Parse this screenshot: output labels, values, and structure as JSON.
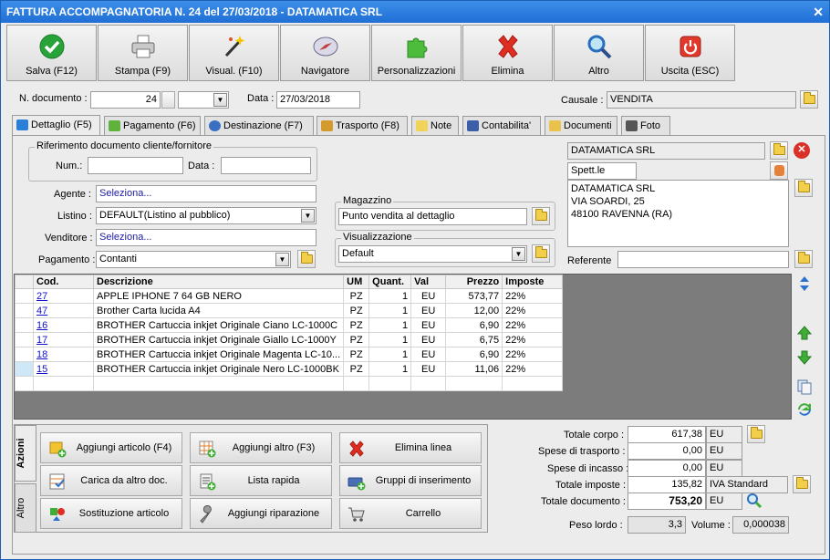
{
  "window": {
    "title": "FATTURA ACCOMPAGNATORIA N. 24 del 27/03/2018 - DATAMATICA SRL"
  },
  "toolbar": {
    "buttons": [
      {
        "label": "Salva (F12)",
        "icon": "check-icon"
      },
      {
        "label": "Stampa (F9)",
        "icon": "printer-icon"
      },
      {
        "label": "Visual. (F10)",
        "icon": "magic-wand-icon"
      },
      {
        "label": "Navigatore",
        "icon": "compass-icon"
      },
      {
        "label": "Personalizzazioni",
        "icon": "puzzle-icon"
      },
      {
        "label": "Elimina",
        "icon": "delete-x-icon"
      },
      {
        "label": "Altro",
        "icon": "magnifier-icon"
      },
      {
        "label": "Uscita (ESC)",
        "icon": "power-icon"
      }
    ]
  },
  "header": {
    "doc_number_label": "N. documento :",
    "doc_number": "24",
    "doc_suffix": "",
    "date_label": "Data :",
    "date": "27/03/2018",
    "causale_label": "Causale :",
    "causale": "VENDITA"
  },
  "tabs": [
    {
      "label": "Dettaglio (F5)",
      "active": true
    },
    {
      "label": "Pagamento (F6)"
    },
    {
      "label": "Destinazione (F7)"
    },
    {
      "label": "Trasporto (F8)"
    },
    {
      "label": "Note"
    },
    {
      "label": "Contabilita'"
    },
    {
      "label": "Documenti"
    },
    {
      "label": "Foto"
    }
  ],
  "riferimento": {
    "title": "Riferimento documento cliente/fornitore",
    "num_label": "Num.:",
    "num": "",
    "data_label": "Data :",
    "data": ""
  },
  "form": {
    "agente_label": "Agente :",
    "agente": "Seleziona...",
    "listino_label": "Listino :",
    "listino": "DEFAULT(Listino al pubblico)",
    "venditore_label": "Venditore :",
    "venditore": "Seleziona...",
    "pagamento_label": "Pagamento :",
    "pagamento": "Contanti"
  },
  "magazzino": {
    "title": "Magazzino",
    "value": "Punto vendita al dettaglio"
  },
  "visualizzazione": {
    "title": "Visualizzazione",
    "value": "Default"
  },
  "cliente": {
    "name": "DATAMATICA SRL",
    "greeting": "Spett.le",
    "address_lines": [
      "DATAMATICA SRL",
      "VIA SOARDI, 25",
      "48100 RAVENNA (RA)"
    ],
    "referente_label": "Referente",
    "referente": ""
  },
  "grid": {
    "columns": [
      "Cod.",
      "Descrizione",
      "UM",
      "Quant.",
      "Val",
      "Prezzo",
      "Imposte"
    ],
    "rows": [
      [
        "27",
        "APPLE IPHONE 7 64 GB NERO",
        "PZ",
        "1",
        "EU",
        "573,77",
        "22%"
      ],
      [
        "47",
        "Brother Carta lucida A4",
        "PZ",
        "1",
        "EU",
        "12,00",
        "22%"
      ],
      [
        "16",
        "BROTHER Cartuccia inkjet Originale Ciano LC-1000C",
        "PZ",
        "1",
        "EU",
        "6,90",
        "22%"
      ],
      [
        "17",
        "BROTHER Cartuccia inkjet Originale Giallo LC-1000Y",
        "PZ",
        "1",
        "EU",
        "6,75",
        "22%"
      ],
      [
        "18",
        "BROTHER Cartuccia inkjet Originale Magenta LC-10...",
        "PZ",
        "1",
        "EU",
        "6,90",
        "22%"
      ],
      [
        "15",
        "BROTHER Cartuccia inkjet Originale Nero LC-1000BK",
        "PZ",
        "1",
        "EU",
        "11,06",
        "22%"
      ]
    ]
  },
  "actions": {
    "vtabs": [
      "Azioni",
      "Altro"
    ],
    "buttons": [
      "Aggiungi articolo (F4)",
      "Aggiungi altro (F3)",
      "Elimina linea",
      "Carica da altro doc.",
      "Lista rapida",
      "Gruppi di inserimento",
      "Sostituzione articolo",
      "Aggiungi riparazione",
      "Carrello"
    ]
  },
  "totals": {
    "totale_corpo_label": "Totale corpo :",
    "totale_corpo": "617,38",
    "spese_trasporto_label": "Spese di trasporto :",
    "spese_trasporto": "0,00",
    "spese_incasso_label": "Spese di incasso :",
    "spese_incasso": "0,00",
    "totale_imposte_label": "Totale imposte :",
    "totale_imposte": "135,82",
    "iva": "IVA Standard",
    "totale_documento_label": "Totale documento :",
    "totale_documento": "753,20",
    "currency": "EU",
    "peso_label": "Peso lordo :",
    "peso": "3,3",
    "volume_label": "Volume :",
    "volume": "0,000038"
  }
}
